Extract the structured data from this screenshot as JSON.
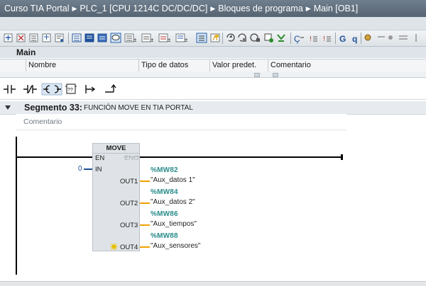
{
  "breadcrumb": [
    "Curso TIA Portal",
    "PLC_1 [CPU 1214C DC/DC/DC]",
    "Bloques de programa",
    "Main [OB1]"
  ],
  "block": {
    "title": "Main"
  },
  "interface": {
    "columns": [
      "Nombre",
      "Tipo de datos",
      "Valor predet.",
      "Comentario"
    ]
  },
  "toolbar_icons": [
    "insert-network-icon",
    "delete-network-icon",
    "insert-row-icon",
    "add-row-icon",
    "network-options-icon",
    "absolute-operand-icon",
    "symbolic-operand-icon",
    "symbol-info-icon",
    "comment-toggle-icon",
    "favorites-icon",
    "expand-all-icon",
    "collapse-all-icon",
    "network-comment-icon",
    "go-to-previous-error-icon",
    "go-to-next-error-icon",
    "update-calls-icon",
    "monitoring-toggle-icon",
    "breakpoint-icon",
    "step-icon",
    "open-block-icon",
    "call-structure-icon",
    "cross-reference-icon",
    "watch-table-icon",
    "compile-icon",
    "more-icon"
  ],
  "ladder_toolbar": [
    {
      "name": "no-contact-icon",
      "glyph": "⊣⊢"
    },
    {
      "name": "nc-contact-icon",
      "glyph": "⊣/⊢"
    },
    {
      "name": "coil-icon",
      "glyph": "–( )–"
    },
    {
      "name": "empty-box-icon",
      "glyph": "[??]"
    },
    {
      "name": "open-branch-icon",
      "glyph": "↦"
    },
    {
      "name": "close-branch-icon",
      "glyph": "↰"
    }
  ],
  "segment": {
    "name": "Segmento 33:",
    "title": "FUNCIÓN MOVE EN TIA PORTAL",
    "comment_placeholder": "Comentario"
  },
  "move_box": {
    "title": "MOVE",
    "en": "EN",
    "eno": "ENO",
    "in_label": "IN",
    "in_value": "0",
    "outputs": [
      {
        "pin": "OUT1",
        "address": "%MW82",
        "tag": "\"Aux_datos 1\""
      },
      {
        "pin": "OUT2",
        "address": "%MW84",
        "tag": "\"Aux_datos 2\""
      },
      {
        "pin": "OUT3",
        "address": "%MW86",
        "tag": "\"Aux_tiempos\""
      },
      {
        "pin": "OUT4",
        "address": "%MW88",
        "tag": "\"Aux_sensores\""
      }
    ]
  },
  "colors": {
    "titlebar": "#5f6e7d",
    "wire_orange": "#f0a000",
    "address": "#2a8b8b",
    "box_fill": "#dfe3e7",
    "new_pin": "#e8c000"
  }
}
